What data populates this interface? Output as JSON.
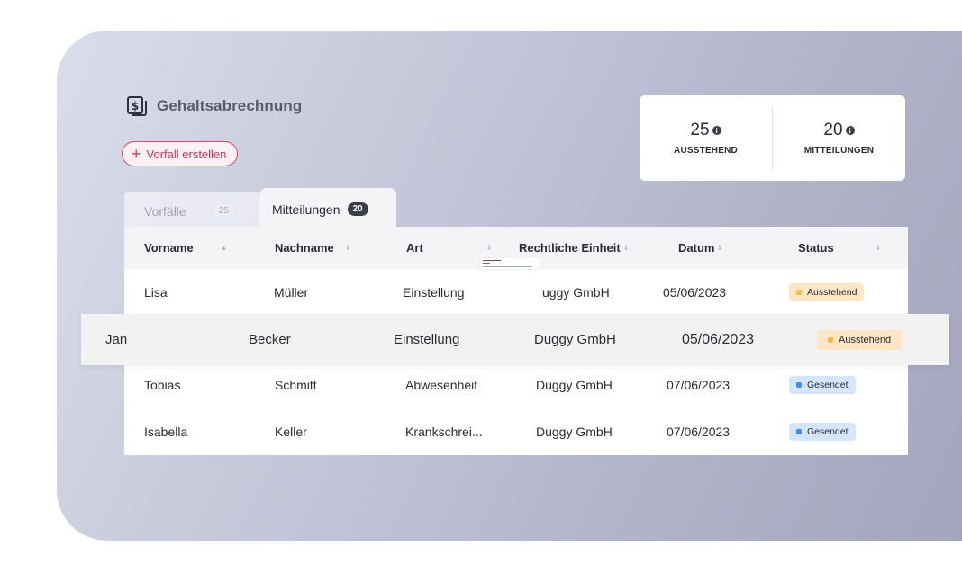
{
  "page": {
    "title": "Gehaltsabrechnung",
    "create_button": "Vorfall erstellen"
  },
  "stats": [
    {
      "value": "25",
      "label": "AUSSTEHEND"
    },
    {
      "value": "20",
      "label": "MITTEILUNGEN"
    }
  ],
  "tabs": [
    {
      "label": "Vorfälle",
      "count": "25",
      "active": false
    },
    {
      "label": "Mitteilungen",
      "count": "20",
      "active": true
    }
  ],
  "table": {
    "columns": [
      "Vorname",
      "Nachname",
      "Art",
      "Rechtliche Einheit",
      "Datum",
      "Status"
    ],
    "rows": [
      {
        "vorname": "Lisa",
        "nachname": "Müller",
        "art": "Einstellung",
        "einheit": "uggy GmbH",
        "datum": "05/06/2023",
        "status": "Ausstehend"
      },
      {
        "vorname": "Tobias",
        "nachname": "Schmitt",
        "art": "Abwesenheit",
        "einheit": "Duggy GmbH",
        "datum": "07/06/2023",
        "status": "Gesendet"
      },
      {
        "vorname": "Isabella",
        "nachname": "Keller",
        "art": "Krankschrei...",
        "einheit": "Duggy GmbH",
        "datum": "07/06/2023",
        "status": "Gesendet"
      }
    ],
    "dragged_row": {
      "vorname": "Jan",
      "nachname": "Becker",
      "art": "Einstellung",
      "einheit": "Duggy GmbH",
      "datum": "05/06/2023",
      "status": "Ausstehend"
    }
  },
  "colors": {
    "accent": "#e04463",
    "pending": "#f6b84a",
    "sent": "#3e8ef0"
  }
}
